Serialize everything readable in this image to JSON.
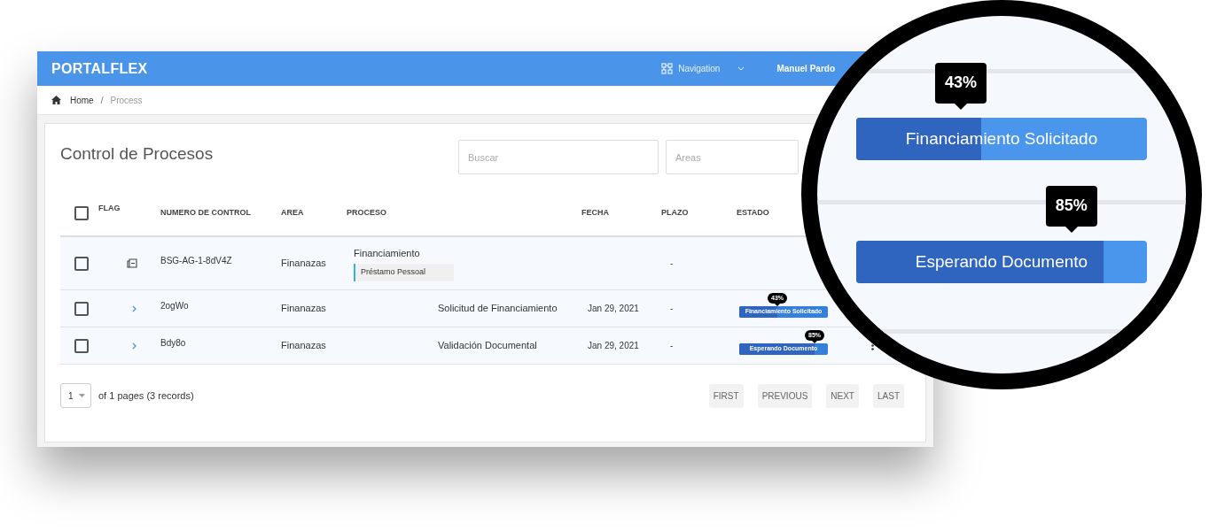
{
  "app": {
    "brand": "PORTALFLEX",
    "nav_menu": "Navigation",
    "user": "Manuel Pardo"
  },
  "breadcrumb": [
    {
      "label": "Home",
      "kind": "home"
    },
    {
      "label": "Process",
      "kind": "current",
      "separator": "/"
    }
  ],
  "page_title": "Control de Procesos",
  "filters": [
    {
      "placeholder": "Buscar"
    },
    {
      "placeholder": "Areas"
    }
  ],
  "table": {
    "select_all_checked": false,
    "columns": [
      "FLAG",
      "NUMERO DE CONTROL",
      "AREA",
      "PROCESO",
      "FECHA",
      "PLAZO",
      "ESTADO"
    ],
    "rows": [
      {
        "kind": "group",
        "checked": false,
        "control": "BSG-AG-1-8dV4Z",
        "area": "Finanazas",
        "process": "Financiamiento",
        "subprocess": "Préstamo Pessoal",
        "plazo": "-"
      },
      {
        "kind": "item",
        "checked": false,
        "control": "2ogWo",
        "area": "Finanazas",
        "process": "Solicitud de Financiamiento",
        "fecha": "Jan 29, 2021",
        "plazo": "-",
        "status": "Financiamiento Solicitado",
        "percent": "43%",
        "level": 0.43
      },
      {
        "kind": "item",
        "checked": false,
        "control": "Bdy8o",
        "area": "Finanazas",
        "process": "Validación Documental",
        "fecha": "Jan 29, 2021",
        "plazo": "-",
        "status": "Esperando Documento",
        "percent": "85%",
        "level": 0.85,
        "menu": true
      }
    ]
  },
  "pagination": {
    "page": "1",
    "summary": "of 1 pages (3 records)",
    "buttons": [
      "FIRST",
      "PREVIOUS",
      "NEXT",
      "LAST"
    ]
  },
  "magnifier": {
    "items": [
      {
        "percent": "43%",
        "status": "Financiamiento Solicitado",
        "level": 0.43
      },
      {
        "percent": "85%",
        "status": "Esperando Documento",
        "level": 0.85
      }
    ]
  }
}
